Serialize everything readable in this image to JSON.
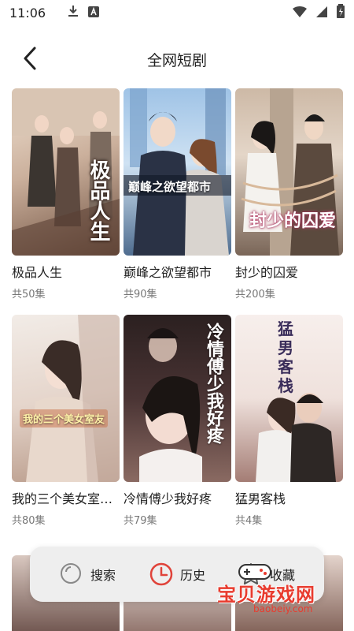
{
  "status_bar": {
    "time": "11:06",
    "icons": [
      "download-icon",
      "app-a-icon",
      "wifi-icon",
      "signal-icon",
      "battery-charging-icon"
    ]
  },
  "header": {
    "title": "全网短剧"
  },
  "dramas": [
    {
      "title": "极品人生",
      "episodes": "共50集",
      "poster_text": "极品人生",
      "colors": [
        "#e9d7c6",
        "#7a5a48"
      ]
    },
    {
      "title": "巅峰之欲望都市",
      "episodes": "共90集",
      "poster_text": "巅峰之欲望都市",
      "colors": [
        "#cfe2f3",
        "#3c4f6b"
      ]
    },
    {
      "title": "封少的囚爱",
      "episodes": "共200集",
      "poster_text": "封少的囚爱",
      "colors": [
        "#d8c7b5",
        "#4a3a30"
      ]
    },
    {
      "title": "我的三个美女室…",
      "episodes": "共80集",
      "poster_text": "我的三个美女室友",
      "colors": [
        "#efe6df",
        "#b59a8a"
      ]
    },
    {
      "title": "冷情傅少我好疼",
      "episodes": "共79集",
      "poster_text": "冷情傅少我好疼",
      "colors": [
        "#3a2a2a",
        "#c9a49a"
      ]
    },
    {
      "title": "猛男客栈",
      "episodes": "共4集",
      "poster_text": "猛男客栈",
      "colors": [
        "#f3e8e4",
        "#a07a74"
      ]
    }
  ],
  "bottom_nav": {
    "search": "搜索",
    "history": "历史",
    "favorite": "收藏"
  },
  "watermark": {
    "text": "宝贝游戏网",
    "url": "baobeiy.com"
  }
}
